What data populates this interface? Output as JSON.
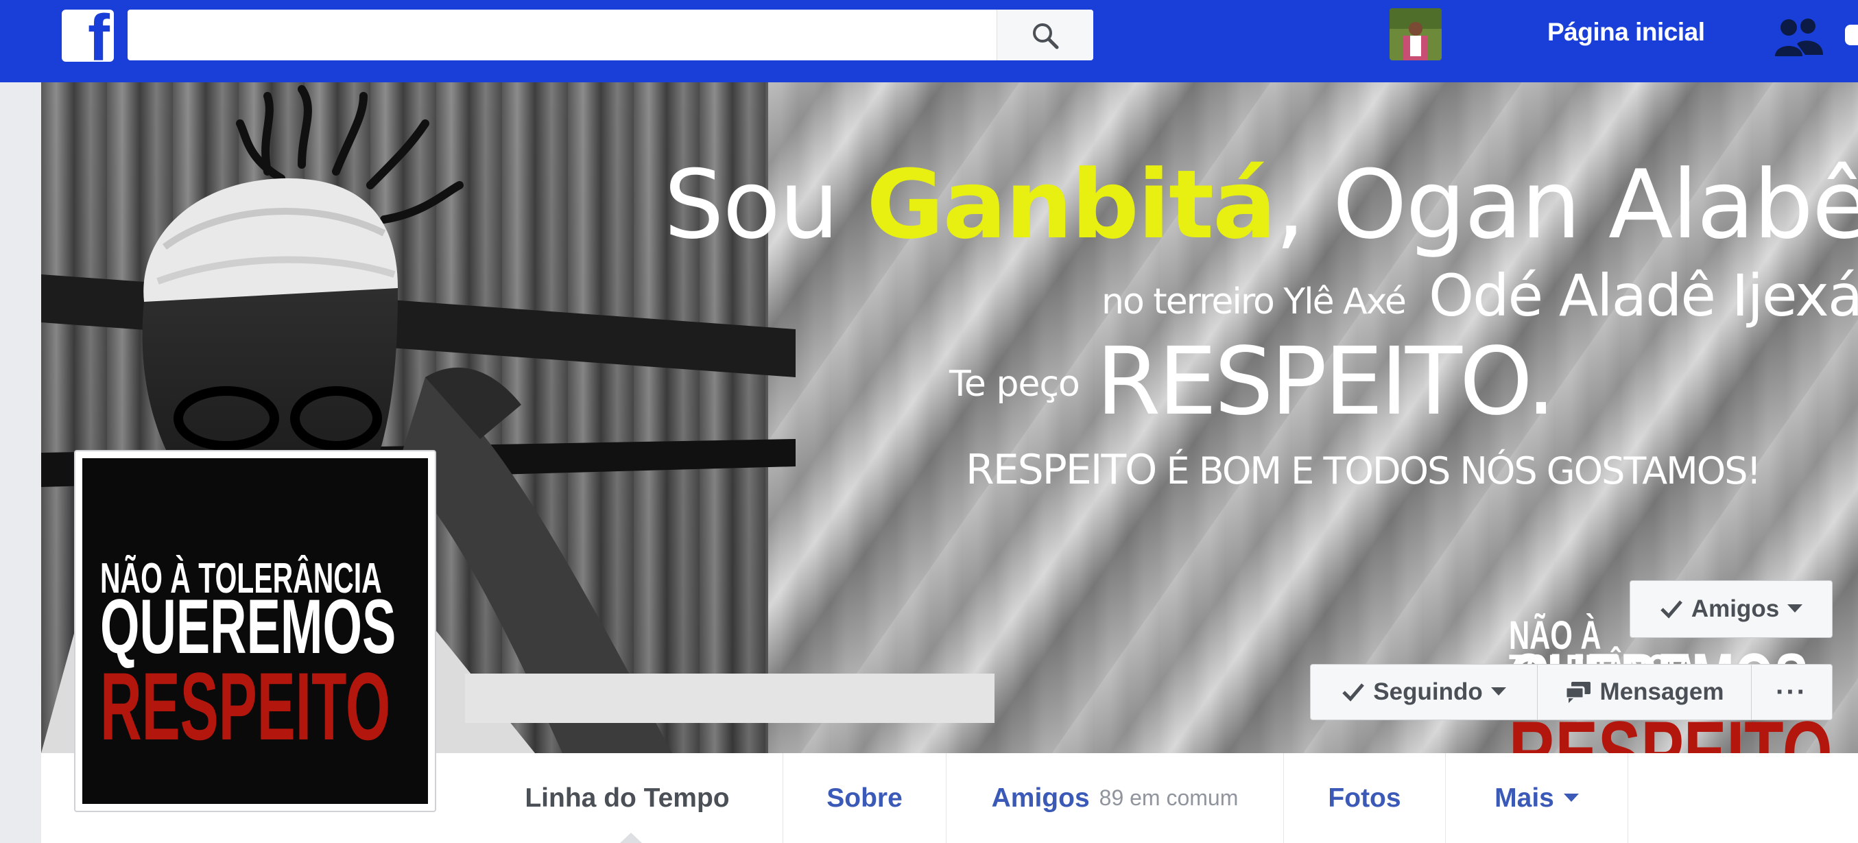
{
  "topbar": {
    "logo_letter": "f",
    "search_placeholder": "",
    "home_label": "Página inicial",
    "icons": [
      "facebook-logo",
      "search-icon",
      "friends-icon",
      "messages-icon"
    ]
  },
  "cover": {
    "line1_prefix": "Sou ",
    "line1_highlight": "Ganbitá",
    "line1_suffix": ", Ogan Alabê",
    "line2_small": "no terreiro Ylê Axé",
    "line2_big": "Odé Aladê Ijexá.",
    "line3_small": "Te peço",
    "line3_big": "RESPEITO.",
    "line4_big": "RESPEITO",
    "line4_rest": " É BOM E TODOS NÓS GOSTAMOS!",
    "highlight_color": "#e7f011"
  },
  "profile_pic": {
    "line1": "NÃO À TOLERÂNCIA",
    "line2": "QUEREMOS",
    "line3": "RESPEITO"
  },
  "actions": {
    "amigos": "Amigos",
    "seguindo": "Seguindo",
    "mensagem": "Mensagem",
    "more": "···"
  },
  "tabs": {
    "timeline": "Linha do Tempo",
    "about": "Sobre",
    "friends": "Amigos",
    "friends_mutual": "89 em comum",
    "photos": "Fotos",
    "more": "Mais"
  },
  "colors": {
    "brand_blue": "#1a3fd8",
    "link_blue": "#3b5ab8",
    "stamp_red": "#b3160c"
  }
}
